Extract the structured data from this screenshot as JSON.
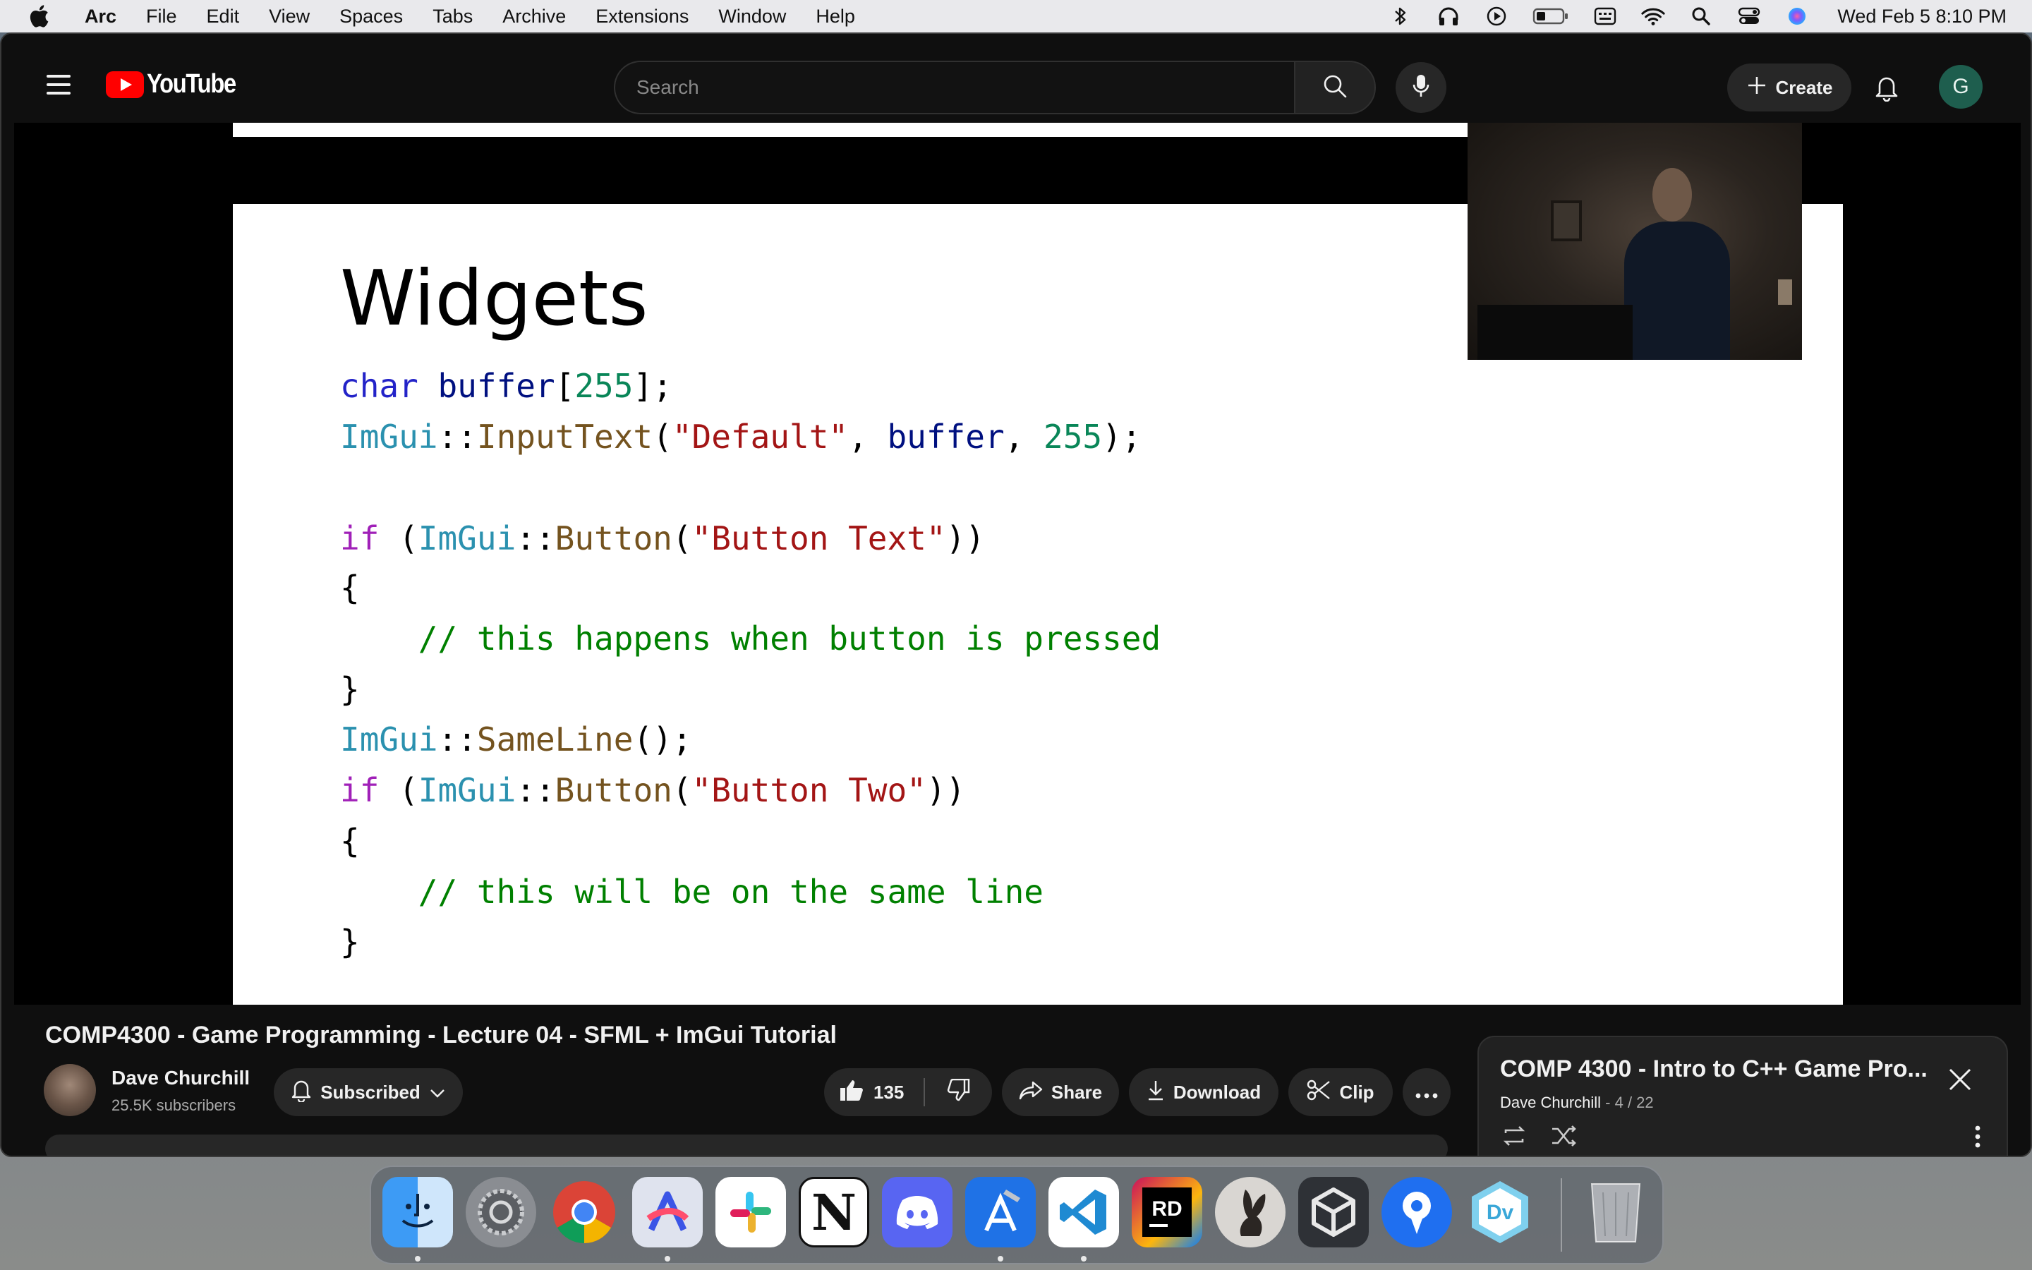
{
  "menubar": {
    "app_name": "Arc",
    "items": [
      "File",
      "Edit",
      "View",
      "Spaces",
      "Tabs",
      "Archive",
      "Extensions",
      "Window",
      "Help"
    ],
    "clock": "Wed Feb 5  8:10 PM",
    "status_icons": [
      "bluetooth-icon",
      "headphones-icon",
      "play-circle-icon",
      "battery-icon",
      "keyboard-input-icon",
      "wifi-icon",
      "spotlight-search-icon",
      "control-center-icon",
      "siri-icon"
    ]
  },
  "youtube": {
    "logo_text": "YouTube",
    "search_placeholder": "Search",
    "create_label": "Create",
    "avatar_letter": "G"
  },
  "slide": {
    "title": "Widgets",
    "code_lines": [
      [
        {
          "t": "char ",
          "c": "kw"
        },
        {
          "t": "buffer",
          "c": "var"
        },
        {
          "t": "[",
          "c": ""
        },
        {
          "t": "255",
          "c": "num"
        },
        {
          "t": "];",
          "c": ""
        }
      ],
      [
        {
          "t": "ImGui",
          "c": "ns"
        },
        {
          "t": "::",
          "c": ""
        },
        {
          "t": "InputText",
          "c": "fn"
        },
        {
          "t": "(",
          "c": ""
        },
        {
          "t": "\"Default\"",
          "c": "str"
        },
        {
          "t": ", ",
          "c": ""
        },
        {
          "t": "buffer",
          "c": "var"
        },
        {
          "t": ", ",
          "c": ""
        },
        {
          "t": "255",
          "c": "num"
        },
        {
          "t": ");",
          "c": ""
        }
      ],
      [],
      [
        {
          "t": "if ",
          "c": "kwp"
        },
        {
          "t": "(",
          "c": ""
        },
        {
          "t": "ImGui",
          "c": "ns"
        },
        {
          "t": "::",
          "c": ""
        },
        {
          "t": "Button",
          "c": "fn"
        },
        {
          "t": "(",
          "c": ""
        },
        {
          "t": "\"Button Text\"",
          "c": "str"
        },
        {
          "t": "))",
          "c": ""
        }
      ],
      [
        {
          "t": "{",
          "c": ""
        }
      ],
      [
        {
          "t": "    // this happens when button is pressed",
          "c": "cm"
        }
      ],
      [
        {
          "t": "}",
          "c": ""
        }
      ],
      [
        {
          "t": "ImGui",
          "c": "ns"
        },
        {
          "t": "::",
          "c": ""
        },
        {
          "t": "SameLine",
          "c": "fn"
        },
        {
          "t": "();",
          "c": ""
        }
      ],
      [
        {
          "t": "if ",
          "c": "kwp"
        },
        {
          "t": "(",
          "c": ""
        },
        {
          "t": "ImGui",
          "c": "ns"
        },
        {
          "t": "::",
          "c": ""
        },
        {
          "t": "Button",
          "c": "fn"
        },
        {
          "t": "(",
          "c": ""
        },
        {
          "t": "\"Button Two\"",
          "c": "str"
        },
        {
          "t": "))",
          "c": ""
        }
      ],
      [
        {
          "t": "{",
          "c": ""
        }
      ],
      [
        {
          "t": "    // this will be on the same line",
          "c": "cm"
        }
      ],
      [
        {
          "t": "}",
          "c": ""
        }
      ]
    ]
  },
  "video": {
    "title": "COMP4300 - Game Programming - Lecture 04 - SFML + ImGui Tutorial",
    "channel_name": "Dave Churchill",
    "channel_subs": "25.5K subscribers",
    "subscribed_label": "Subscribed",
    "like_count": "135",
    "share_label": "Share",
    "download_label": "Download",
    "clip_label": "Clip"
  },
  "playlist": {
    "title": "COMP 4300 - Intro to C++ Game Pro...",
    "owner": "Dave Churchill",
    "position": " - 4 / 22"
  },
  "dock": {
    "apps": [
      "finder-icon",
      "system-settings-icon",
      "chrome-icon",
      "arc-browser-icon",
      "slack-icon",
      "notion-icon",
      "discord-icon",
      "xcode-icon",
      "vscode-icon",
      "rider-icon",
      "bunny-app-icon",
      "unity-icon",
      "proxyman-icon",
      "devutils-icon"
    ],
    "trash": "trash-icon"
  },
  "colors": {
    "yt_bg": "#0f0f0f",
    "yt_red": "#ff0000",
    "pill_bg": "#272727",
    "code_comment": "#008000",
    "code_string": "#a31515"
  }
}
